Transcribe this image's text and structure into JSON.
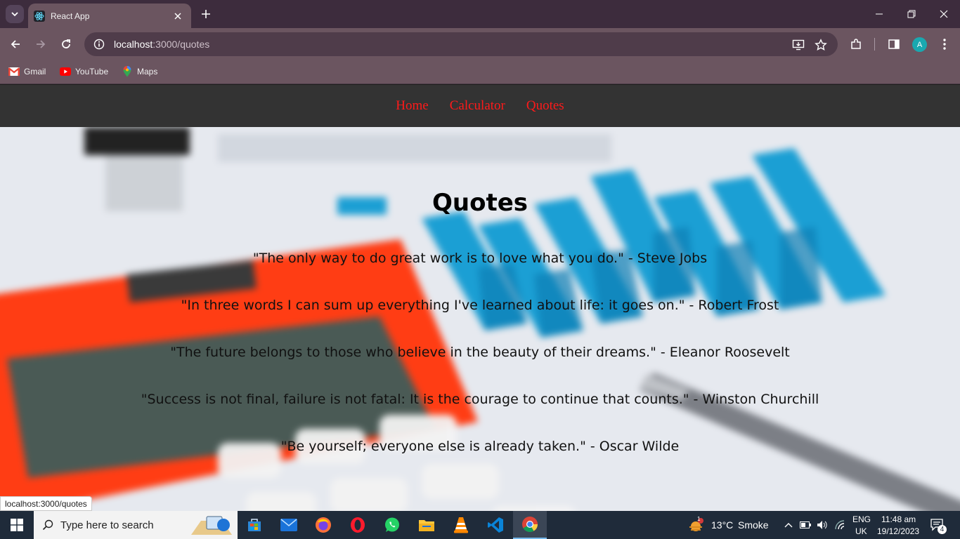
{
  "browser": {
    "tab_title": "React App",
    "url_host": "localhost",
    "url_path": ":3000/quotes",
    "bookmarks": [
      "Gmail",
      "YouTube",
      "Maps"
    ],
    "avatar_letter": "A"
  },
  "app_nav": {
    "links": [
      "Home",
      "Calculator",
      "Quotes"
    ],
    "link_color": "#ff1a1a"
  },
  "page": {
    "title": "Quotes",
    "quotes": [
      "\"The only way to do great work is to love what you do.\" - Steve Jobs",
      "\"In three words I can sum up everything I've learned about life: it goes on.\" - Robert Frost",
      "\"The future belongs to those who believe in the beauty of their dreams.\" - Eleanor Roosevelt",
      "\"Success is not final, failure is not fatal: It is the courage to continue that counts.\" - Winston Churchill",
      "\"Be yourself; everyone else is already taken.\" - Oscar Wilde"
    ]
  },
  "status_bar_url": "localhost:3000/quotes",
  "taskbar": {
    "search_placeholder": "Type here to search",
    "weather_temp": "13°C",
    "weather_desc": "Smoke",
    "lang_top": "ENG",
    "lang_bottom": "UK",
    "time": "11:48 am",
    "date": "19/12/2023",
    "notification_count": "4",
    "weather_badge": "1"
  }
}
